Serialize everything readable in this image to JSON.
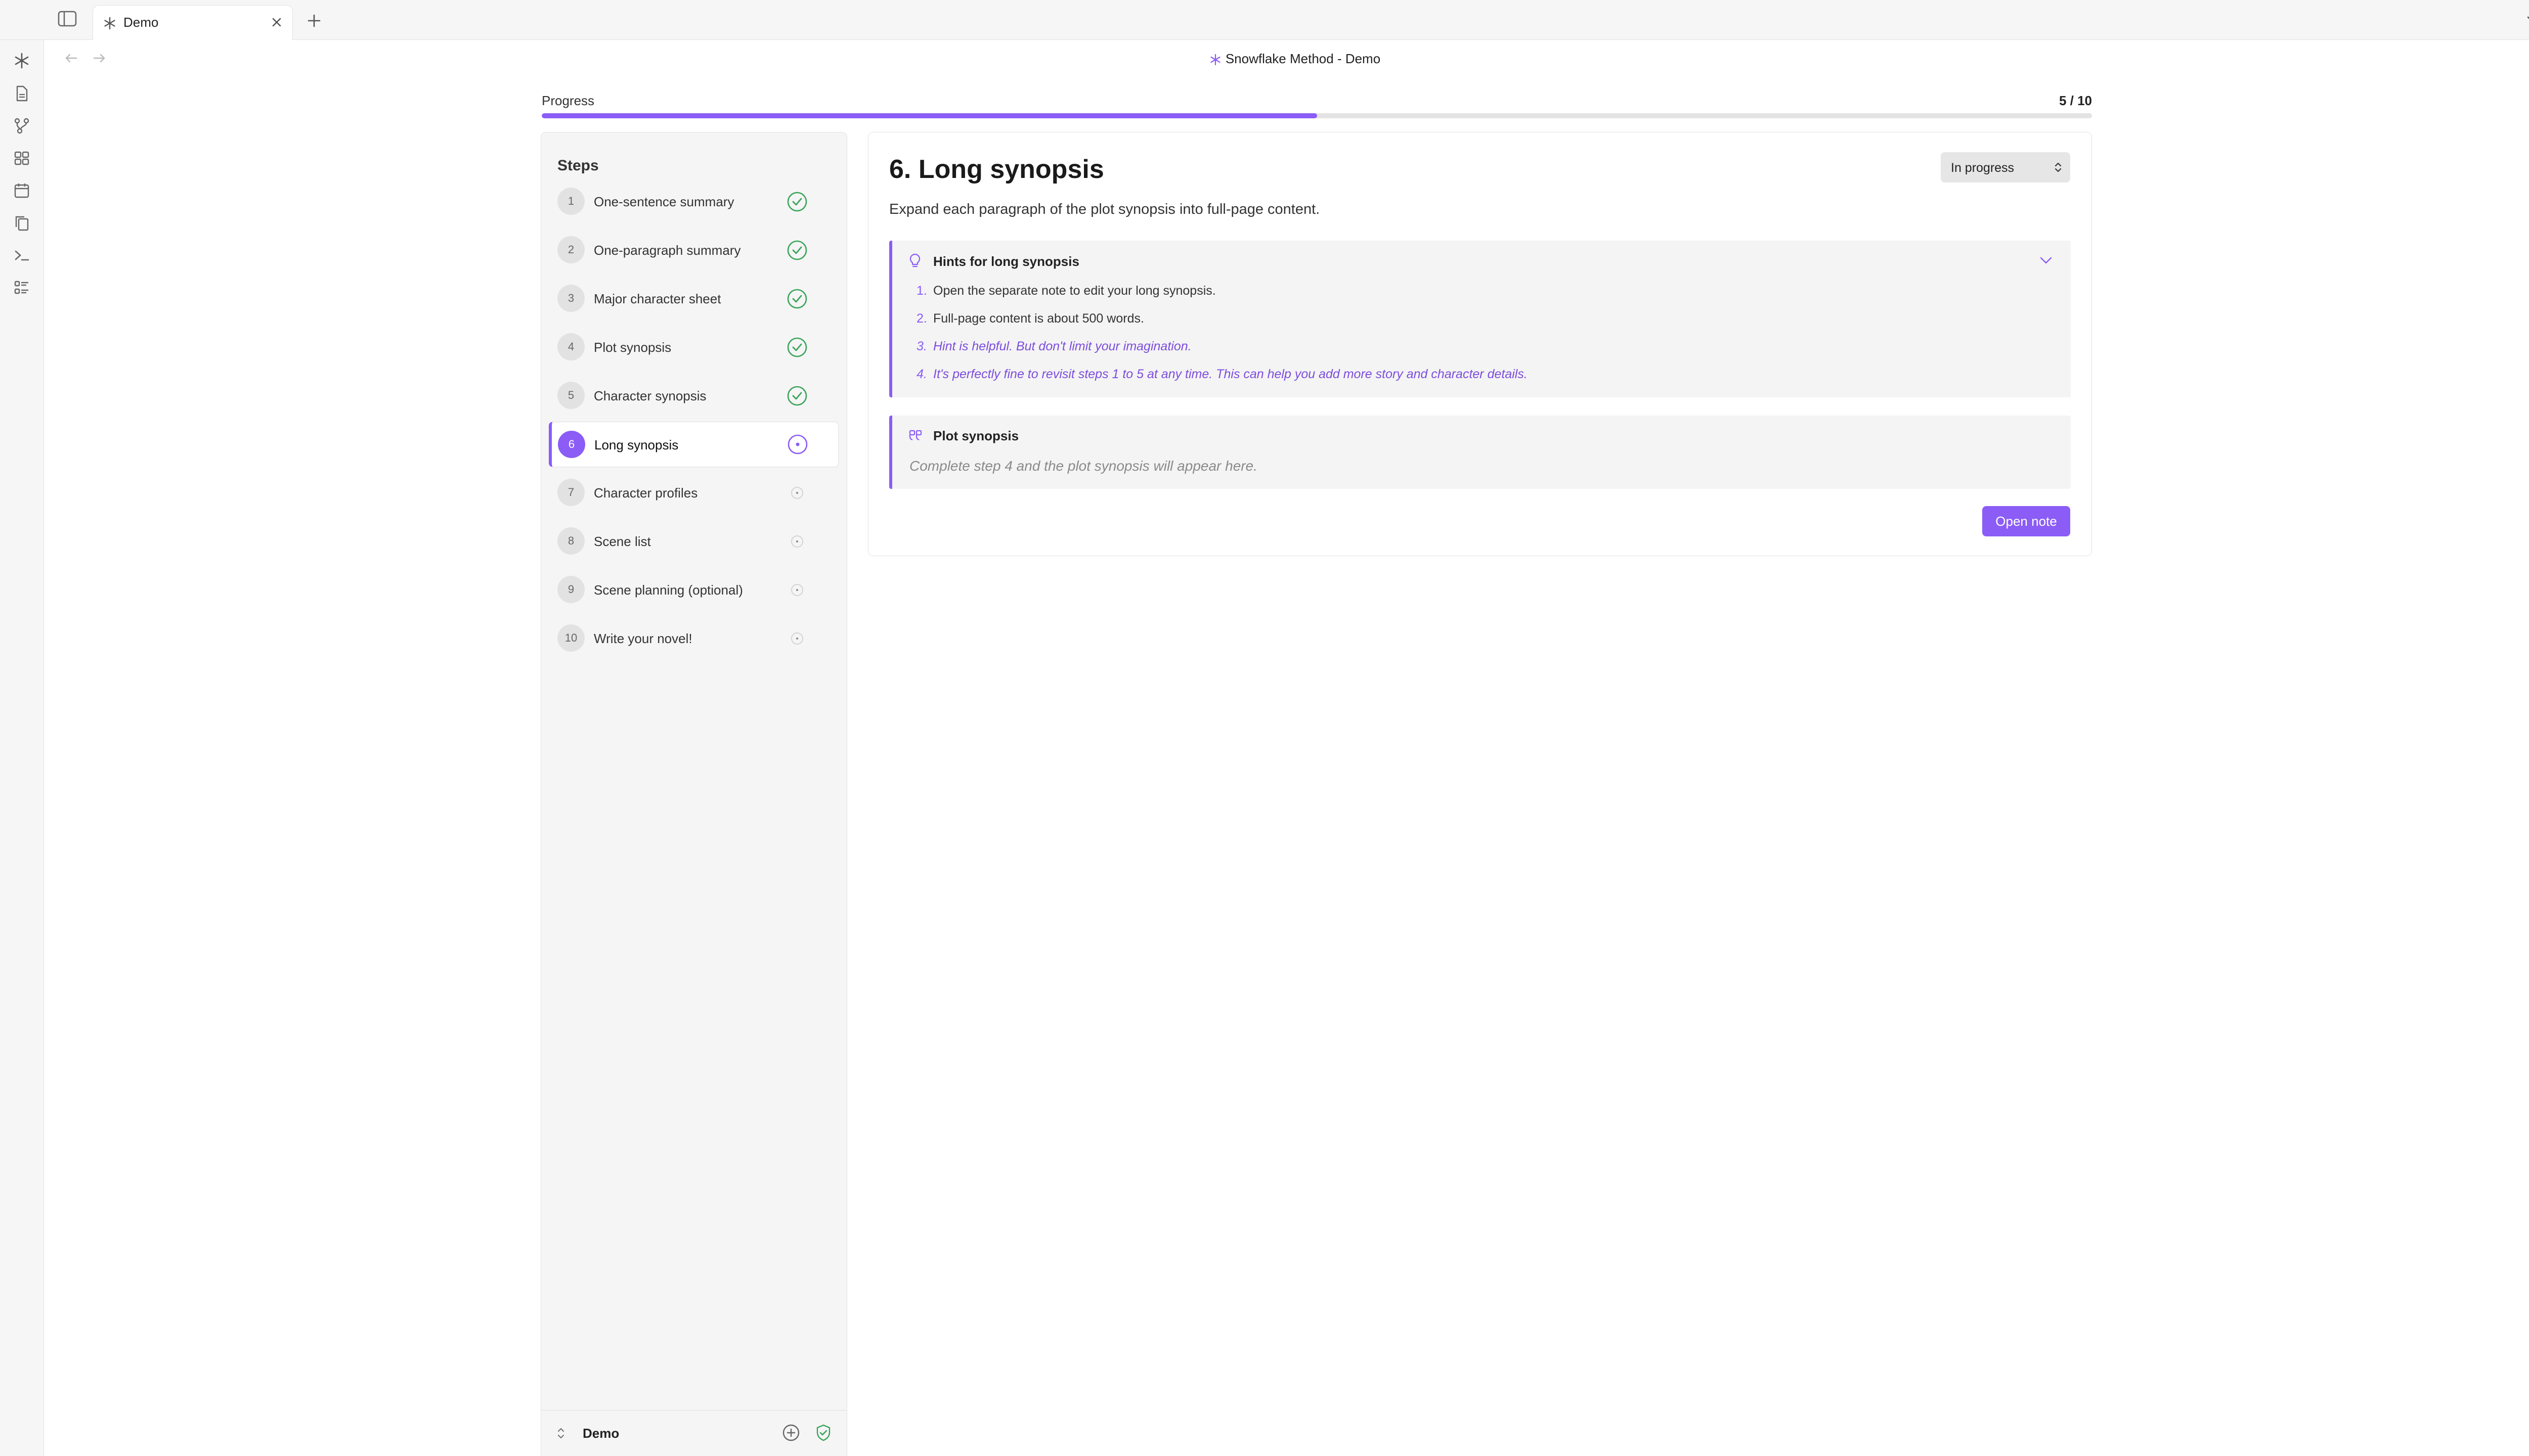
{
  "window": {
    "tab_title": "Demo",
    "title": "Snowflake Method - Demo"
  },
  "progress": {
    "label": "Progress",
    "count_text": "5 / 10",
    "completed": 5,
    "total": 10
  },
  "steps": {
    "heading": "Steps",
    "items": [
      {
        "num": "1",
        "label": "One-sentence summary",
        "status": "done"
      },
      {
        "num": "2",
        "label": "One-paragraph summary",
        "status": "done"
      },
      {
        "num": "3",
        "label": "Major character sheet",
        "status": "done"
      },
      {
        "num": "4",
        "label": "Plot synopsis",
        "status": "done"
      },
      {
        "num": "5",
        "label": "Character synopsis",
        "status": "done"
      },
      {
        "num": "6",
        "label": "Long synopsis",
        "status": "in-progress"
      },
      {
        "num": "7",
        "label": "Character profiles",
        "status": "todo"
      },
      {
        "num": "8",
        "label": "Scene list",
        "status": "todo"
      },
      {
        "num": "9",
        "label": "Scene planning (optional)",
        "status": "todo"
      },
      {
        "num": "10",
        "label": "Write your novel!",
        "status": "todo"
      }
    ],
    "footer_label": "Demo"
  },
  "main": {
    "title": "6. Long synopsis",
    "status_value": "In progress",
    "description": "Expand each paragraph of the plot synopsis into full-page content.",
    "hints": {
      "title": "Hints for long synopsis",
      "items": [
        {
          "num": "1.",
          "text": "Open the separate note to edit your long synopsis."
        },
        {
          "num": "2.",
          "text": "Full-page content is about 500 words."
        },
        {
          "num": "3.",
          "text": "Hint is helpful. But don't limit your imagination."
        },
        {
          "num": "4.",
          "text": "It's perfectly fine to revisit steps 1 to 5 at any time. This can help you add more story and character details."
        }
      ]
    },
    "plot_synopsis": {
      "title": "Plot synopsis",
      "placeholder": "Complete step 4 and the plot synopsis will appear here."
    },
    "open_note_label": "Open note"
  },
  "colors": {
    "accent": "#8b5cf6",
    "done": "#3aa55a",
    "track": "#e3e3e3"
  },
  "icons": [
    "sidebar-toggle-icon",
    "snowflake-icon",
    "close-icon",
    "plus-icon",
    "chevron-down-icon",
    "right-sidebar-icon",
    "back-arrow-icon",
    "forward-arrow-icon",
    "more-icon",
    "file-icon",
    "graph-icon",
    "grid-icon",
    "calendar-icon",
    "copy-icon",
    "terminal-icon",
    "list-icon",
    "lightbulb-icon",
    "quote-icon",
    "check-circle-icon",
    "in-progress-icon",
    "pending-icon",
    "add-circle-icon",
    "shield-check-icon",
    "sync-off-icon"
  ]
}
